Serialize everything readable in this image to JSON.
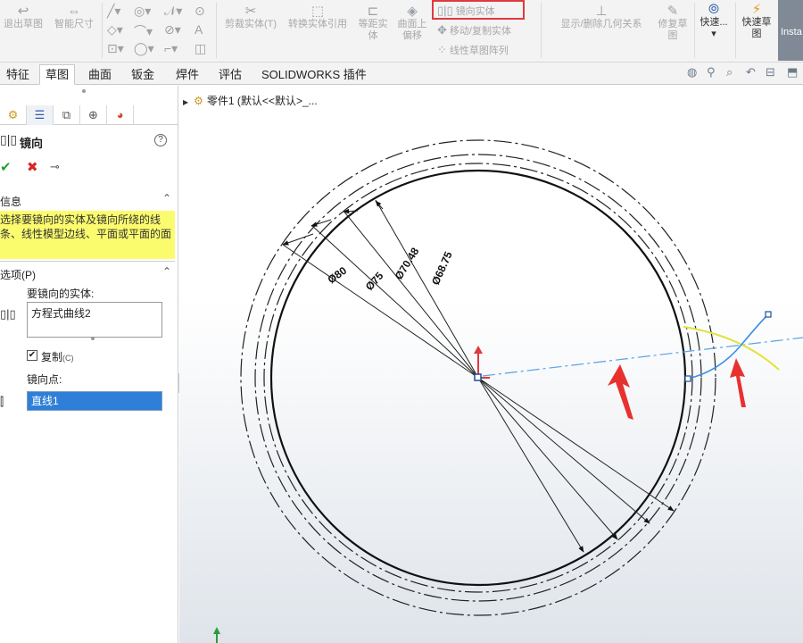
{
  "ribbon": {
    "exit_sketch": "退出草图",
    "smart_dimension": "智能尺寸",
    "trim_entities": "剪裁实体(T)",
    "convert_entities": "转换实体引用",
    "offset_entities_1": "等距实",
    "offset_entities_2": "体",
    "offset_on_surface_1": "曲面上",
    "offset_on_surface_2": "偏移",
    "mirror_entities": "镜向实体",
    "move_copy": "移动/复制实体",
    "linear_pattern": "线性草图阵列",
    "display_relations": "显示/删除几何关系",
    "repair_sketch_1": "修复草",
    "repair_sketch_2": "图",
    "quick_snaps": "快速...",
    "rapid_sketch_1": "快速草",
    "rapid_sketch_2": "图",
    "instant": "Insta"
  },
  "tabs": [
    "特征",
    "草图",
    "曲面",
    "钣金",
    "焊件",
    "评估",
    "SOLIDWORKS 插件"
  ],
  "active_tab": "草图",
  "tree": {
    "part_label": "零件1  (默认<<默认>_..."
  },
  "panel": {
    "title": "镜向",
    "help": "?",
    "info_header": "信息",
    "info_text": "选择要镜向的实体及镜向所绕的线条、线性模型边线、平面或平面的面",
    "options_header": "选项(P)",
    "entities_label": "要镜向的实体:",
    "entities_value": "方程式曲线2",
    "copy_label": "复制",
    "copy_shortcut": "(C)",
    "copy_checked": true,
    "mirror_about_label": "镜向点:",
    "mirror_about_value": "直线1"
  },
  "dimensions": {
    "d80": "Ø80",
    "d75": "Ø75",
    "d70": "Ø70.48",
    "d68": "Ø68.75"
  },
  "colors": {
    "selection_blue": "#2f7fd8",
    "info_yellow": "#fbfb6e",
    "highlight_red": "#e0393e",
    "annotation_arrow": "#e8312f",
    "curve_blue": "#3a8ee6",
    "curve_yellow": "#e2e23a"
  }
}
